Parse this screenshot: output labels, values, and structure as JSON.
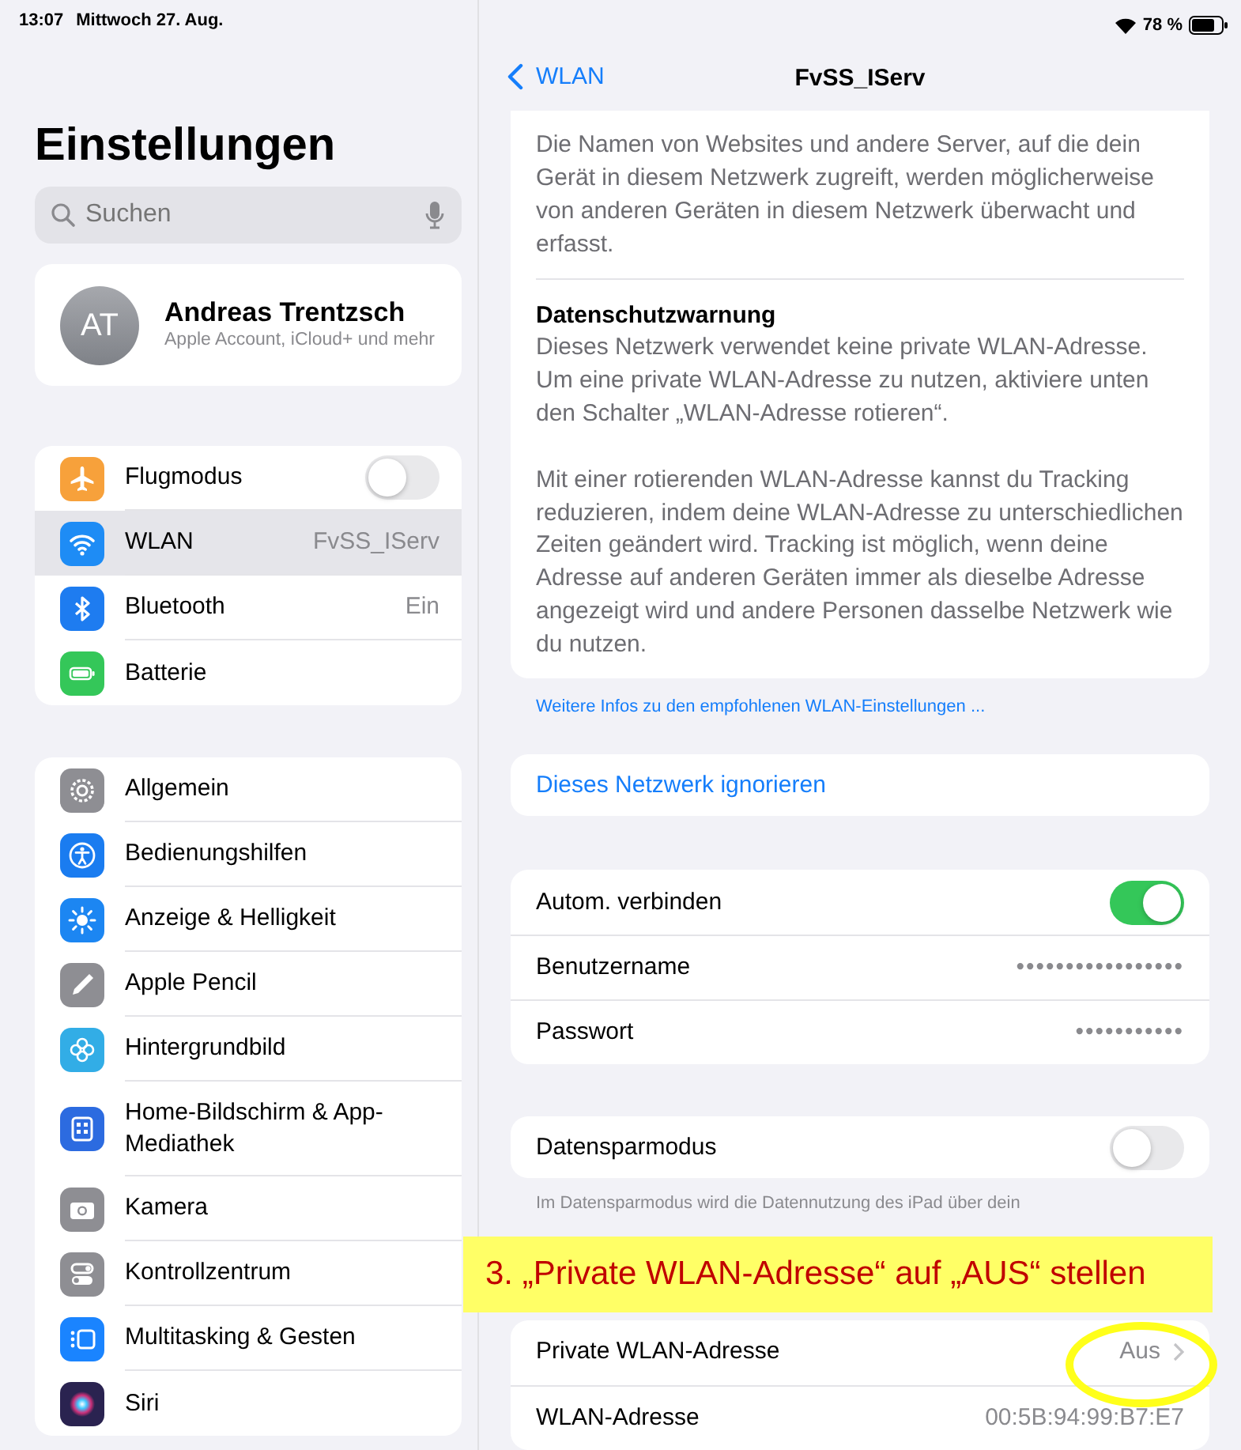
{
  "status_bar": {
    "time": "13:07",
    "date": "Mittwoch 27. Aug.",
    "battery": "78 %"
  },
  "sidebar": {
    "title": "Einstellungen",
    "search": {
      "placeholder": "Suchen"
    },
    "account": {
      "initials": "AT",
      "name": "Andreas Trentzsch",
      "subtitle": "Apple Account, iCloud+ und mehr"
    },
    "groups": [
      [
        {
          "kind": "toggle",
          "label": "Flugmodus",
          "on": false,
          "selected": false,
          "color": "#f7a13b"
        },
        {
          "kind": "value",
          "label": "WLAN",
          "value": "FvSS_IServ",
          "selected": true,
          "color": "#1e8cf5"
        },
        {
          "kind": "value",
          "label": "Bluetooth",
          "value": "Ein",
          "selected": false,
          "color": "#1e7cf0"
        },
        {
          "kind": "plain",
          "label": "Batterie",
          "selected": false,
          "color": "#34c759"
        }
      ],
      [
        {
          "kind": "plain",
          "label": "Allgemein",
          "selected": false,
          "color": "#8e8e93"
        },
        {
          "kind": "plain",
          "label": "Bedienungshilfen",
          "selected": false,
          "color": "#1a7cf0"
        },
        {
          "kind": "plain",
          "label": "Anzeige & Helligkeit",
          "selected": false,
          "color": "#1c86f2"
        },
        {
          "kind": "plain",
          "label": "Apple Pencil",
          "selected": false,
          "color": "#8e8e93"
        },
        {
          "kind": "plain",
          "label": "Hintergrundbild",
          "selected": false,
          "color": "#32ade6"
        },
        {
          "kind": "plain",
          "label": "Home-Bildschirm & App-Mediathek",
          "selected": false,
          "color": "#2c6be0"
        },
        {
          "kind": "plain",
          "label": "Kamera",
          "selected": false,
          "color": "#8e8e93"
        },
        {
          "kind": "plain",
          "label": "Kontrollzentrum",
          "selected": false,
          "color": "#8e8e93"
        },
        {
          "kind": "plain",
          "label": "Multitasking & Gesten",
          "selected": false,
          "color": "#1a84ff"
        },
        {
          "kind": "plain",
          "label": "Siri",
          "selected": false,
          "color": "#2a2350"
        }
      ]
    ]
  },
  "detail": {
    "back": "WLAN",
    "title": "FvSS_IServ",
    "privacy_card": {
      "paragraph": "Die Namen von Websites und andere Server, auf die dein Gerät in diesem Netzwerk zugreift, werden möglicherweise von anderen Geräten in diesem Netzwerk überwacht und erfasst.",
      "warning_title": "Datenschutzwarnung",
      "warning_paragraphs": [
        "Dieses Netzwerk verwendet keine private WLAN-Adresse. Um eine private WLAN-Adresse zu nutzen, aktiviere unten den Schalter „WLAN-Adresse rotieren“.",
        "Mit einer rotierenden WLAN-Adresse kannst du Tracking reduzieren, indem deine WLAN-Adresse zu unterschiedlichen Zeiten geändert wird. Tracking ist möglich, wenn deine Adresse auf anderen Geräten immer als dieselbe Adresse angezeigt wird und andere Personen dasselbe Netzwerk wie du nutzen."
      ]
    },
    "info_link": "Weitere Infos zu den empfohlenen WLAN-Einstellungen ...",
    "forget_button": "Dieses Netzwerk ignorieren",
    "settings": [
      {
        "kind": "toggle",
        "label": "Autom. verbinden",
        "on": true
      },
      {
        "kind": "value",
        "label": "Benutzername",
        "value": "•••••••••••••••••"
      },
      {
        "kind": "value",
        "label": "Passwort",
        "value": "•••••••••••"
      }
    ],
    "data_saver": {
      "label": "Datensparmodus",
      "on": false,
      "footnote": "Im Datensparmodus wird die Datennutzung des iPad über dein"
    },
    "address_rows": [
      {
        "kind": "link",
        "label": "Private WLAN-Adresse",
        "value": "Aus"
      },
      {
        "kind": "value",
        "label": "WLAN-Adresse",
        "value": "00:5B:94:99:B7:E7"
      }
    ]
  },
  "annotation": {
    "text": "3. „Private WLAN-Adresse“ auf „AUS“ stellen"
  }
}
